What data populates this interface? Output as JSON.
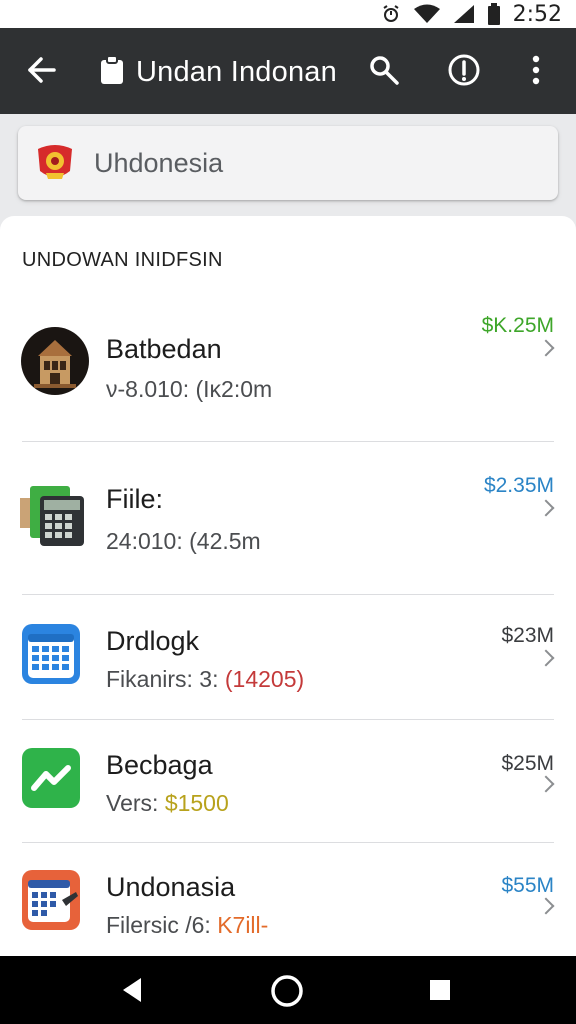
{
  "status_bar": {
    "time": "2:52",
    "icons": [
      "alarm-icon",
      "wifi-icon",
      "signal-icon",
      "battery-icon"
    ]
  },
  "app_bar": {
    "title": "Undan Indonan",
    "icons": [
      "back-arrow-icon",
      "clipboard-icon",
      "search-icon",
      "info-icon",
      "more-vert-icon"
    ]
  },
  "search": {
    "value": "Uhdonesia"
  },
  "section": {
    "header": "UNDOWAN INIDFSIN"
  },
  "list": [
    {
      "title": "Batbedan",
      "subtitle": "ν-8.010: (Iκ2:0m",
      "subtitle_accent": "",
      "price": "$K.25M",
      "price_color": "#3ea62a",
      "icon": "building-icon"
    },
    {
      "title": "Fiile:",
      "subtitle": "24:010: (42.5m",
      "subtitle_accent": "",
      "price": "$2.35M",
      "price_color": "#2b84c6",
      "icon": "calculator-icon"
    },
    {
      "title": "Drdlogk",
      "subtitle": "Fikanirs: 3:",
      "subtitle_accent": "(14205)",
      "subtitle_accent_color": "#c43a3a",
      "price": "$23M",
      "price_color": "#3b3d40",
      "icon": "calendar-grid-icon"
    },
    {
      "title": "Becbaga",
      "subtitle": "Vers:",
      "subtitle_accent": "$1500",
      "subtitle_accent_color": "#b8a21c",
      "price": "$25M",
      "price_color": "#3b3d40",
      "icon": "trend-chart-icon"
    },
    {
      "title": "Undonasia",
      "subtitle": "Filersic /6:",
      "subtitle_accent": "K7ill-",
      "subtitle_accent_color": "#e36b2a",
      "price": "$55M",
      "price_color": "#2b84c6",
      "icon": "calendar-edit-icon"
    }
  ],
  "nav_bar": {
    "icons": [
      "back-triangle-icon",
      "home-circle-icon",
      "recents-square-icon"
    ]
  }
}
